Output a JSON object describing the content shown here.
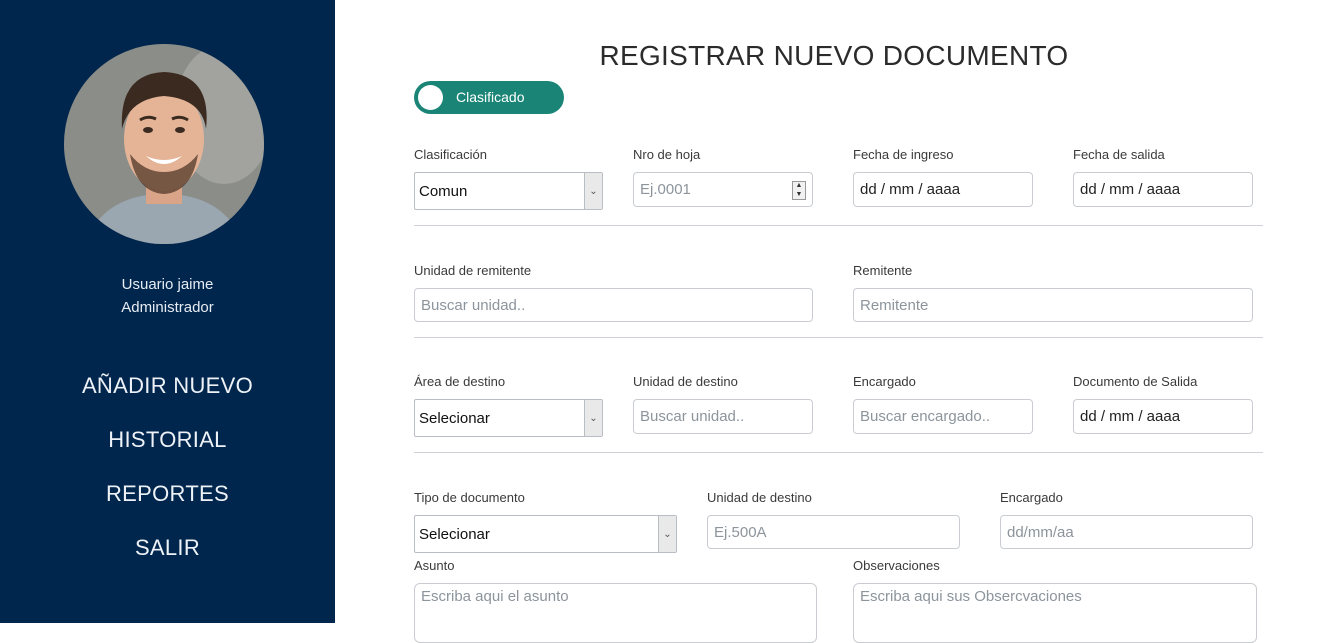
{
  "sidebar": {
    "user_name": "Usuario jaime",
    "user_role": "Administrador",
    "nav": [
      "AÑADIR NUEVO",
      "HISTORIAL",
      "REPORTES",
      "SALIR"
    ]
  },
  "form": {
    "title": "REGISTRAR NUEVO DOCUMENTO",
    "toggle_label": "Clasificado",
    "row1": {
      "clasificacion_label": "Clasificación",
      "clasificacion_value": "Comun",
      "nro_hoja_label": "Nro de hoja",
      "nro_hoja_placeholder": "Ej.0001",
      "fecha_ingreso_label": "Fecha de ingreso",
      "fecha_ingreso_value": "dd / mm / aaaa",
      "fecha_salida_label": "Fecha de salida",
      "fecha_salida_value": "dd / mm / aaaa"
    },
    "row2": {
      "unidad_remitente_label": "Unidad de remitente",
      "unidad_remitente_placeholder": "Buscar unidad..",
      "remitente_label": "Remitente",
      "remitente_placeholder": "Remitente"
    },
    "row3": {
      "area_destino_label": "Área de destino",
      "area_destino_value": "Selecionar",
      "unidad_destino_label": "Unidad de destino",
      "unidad_destino_placeholder": "Buscar unidad..",
      "encargado_label": "Encargado",
      "encargado_placeholder": "Buscar encargado..",
      "documento_salida_label": "Documento de Salida",
      "documento_salida_value": "dd / mm / aaaa"
    },
    "row4": {
      "tipo_documento_label": "Tipo de documento",
      "tipo_documento_value": "Selecionar",
      "unidad_destino_label": "Unidad de destino",
      "unidad_destino_placeholder": "Ej.500A",
      "encargado_label": "Encargado",
      "encargado_placeholder": "dd/mm/aa"
    },
    "row5": {
      "asunto_label": "Asunto",
      "asunto_placeholder": "Escriba aqui el asunto",
      "observaciones_label": "Observaciones",
      "observaciones_placeholder": "Escriba aqui sus Obsercvaciones"
    }
  },
  "colors": {
    "sidebar_bg": "#00264d",
    "toggle_bg": "#1a8577"
  }
}
